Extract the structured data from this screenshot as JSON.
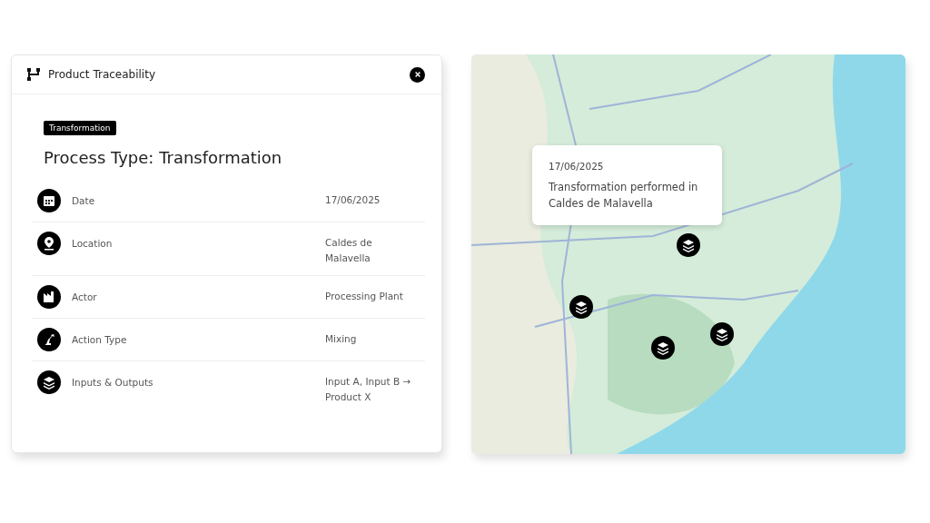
{
  "panel": {
    "title": "Product Traceability",
    "badge": "Transformation",
    "heading": "Process Type: Transformation",
    "rows": [
      {
        "kind": "date",
        "label": "Date",
        "value": "17/06/2025"
      },
      {
        "kind": "location",
        "label": "Location",
        "value": "Caldes de Malavella"
      },
      {
        "kind": "actor",
        "label": "Actor",
        "value": "Processing Plant"
      },
      {
        "kind": "action",
        "label": "Action Type",
        "value": "Mixing"
      },
      {
        "kind": "io",
        "label": "Inputs & Outputs",
        "value": "Input A, Input B → Product X"
      }
    ]
  },
  "map": {
    "tooltip": {
      "date": "17/06/2025",
      "text": "Transformation performed in Caldes de Malavella"
    }
  }
}
